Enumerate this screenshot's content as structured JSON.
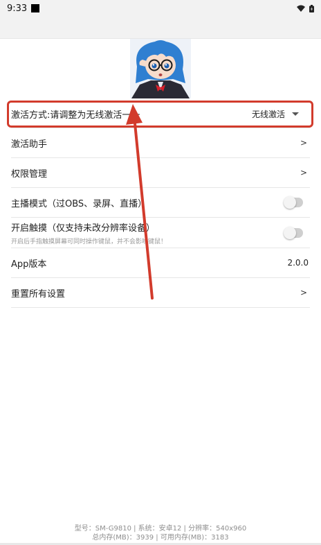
{
  "status_bar": {
    "time": "9:33"
  },
  "settings": {
    "activation": {
      "label": "激活方式:请调整为无线激活一一",
      "selected": "无线激活"
    },
    "assistant": {
      "label": "激活助手",
      "chevron": ">"
    },
    "permissions": {
      "label": "权限管理",
      "chevron": ">"
    },
    "streamer_mode": {
      "label": "主播模式（过OBS、录屏、直播）"
    },
    "touch": {
      "label": "开启触摸（仅支持未改分辨率设备）",
      "hint": "开启后手指触摸屏幕可同时操作键鼠，并不会影响键鼠！"
    },
    "app_version": {
      "label": "App版本",
      "value": "2.0.0"
    },
    "reset": {
      "label": "重置所有设置",
      "chevron": ">"
    }
  },
  "footer": {
    "line1": "型号：SM-G9810 | 系统：安卓12 | 分辨率：540x960",
    "line2": "总内存(MB)：3939 | 可用内存(MB)：3183"
  },
  "colors": {
    "annotation": "#d23b2c",
    "toggle_off": "#cfcfcf"
  }
}
